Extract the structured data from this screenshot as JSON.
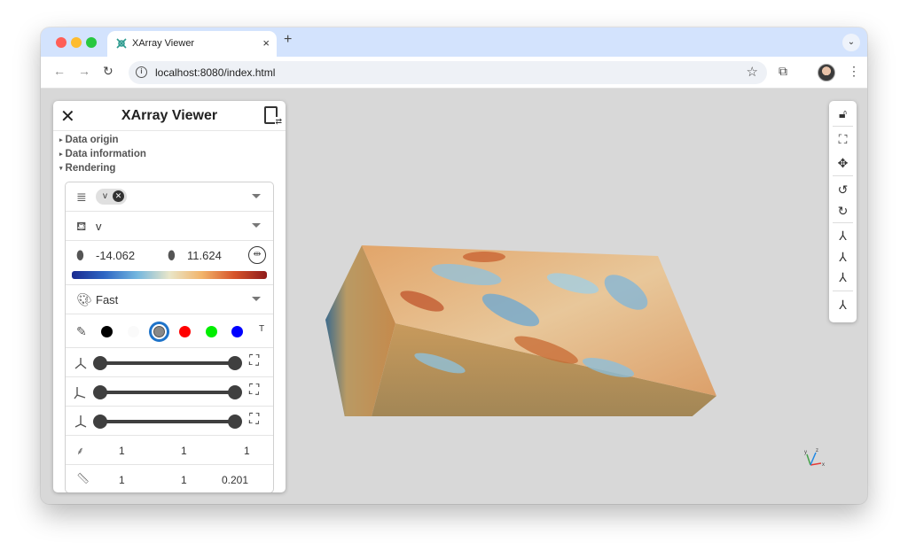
{
  "browser": {
    "tab_title": "XArray Viewer",
    "tab_close": "×",
    "new_tab": "+",
    "tab_menu": "⌄",
    "url": "localhost:8080/index.html"
  },
  "panel": {
    "title": "XArray Viewer",
    "sections": [
      "Data origin",
      "Data information",
      "Rendering"
    ],
    "array_chip": "v",
    "color_by": "v",
    "range_min": "-14.062",
    "range_max": "11.624",
    "preset": "Fast",
    "colors": [
      "#000000",
      "#ffffff",
      "#888888",
      "#ff0000",
      "#00ff00",
      "#0000ff"
    ],
    "selected_color_index": 2,
    "opacity_label": "T",
    "slice_ranges": [
      {
        "axis": "x",
        "min": 0,
        "max": 1
      },
      {
        "axis": "y",
        "min": 0,
        "max": 1
      },
      {
        "axis": "z",
        "min": 0,
        "max": 1
      }
    ],
    "step": [
      "1",
      "1",
      "1"
    ],
    "spacing": [
      "1",
      "1",
      "0.201"
    ]
  },
  "icons": {
    "close": "close-icon",
    "file": "file-swap-icon",
    "database": "database-icon",
    "paint": "paint-bucket-icon",
    "palette": "palette-icon",
    "eyedropper": "eyedropper-icon"
  }
}
